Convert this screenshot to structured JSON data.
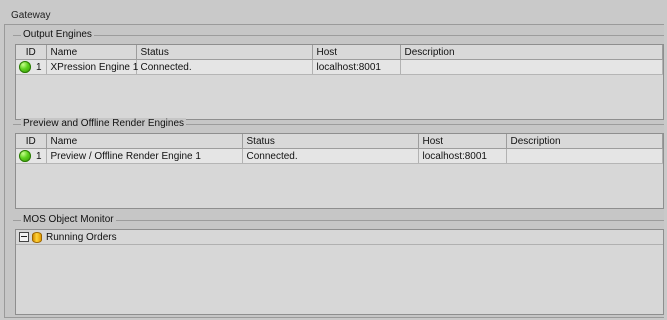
{
  "window": {
    "title": "Gateway"
  },
  "output_engines": {
    "legend": "Output Engines",
    "columns": [
      "ID",
      "Name",
      "Status",
      "Host",
      "Description"
    ],
    "rows": [
      {
        "id": "1",
        "name": "XPression Engine 1",
        "status": "Connected.",
        "host": "localhost:8001",
        "description": ""
      }
    ]
  },
  "preview_engines": {
    "legend": "Preview and Offline Render Engines",
    "columns": [
      "ID",
      "Name",
      "Status",
      "Host",
      "Description"
    ],
    "rows": [
      {
        "id": "1",
        "name": "Preview / Offline Render Engine 1",
        "status": "Connected.",
        "host": "localhost:8001",
        "description": ""
      }
    ]
  },
  "mos_monitor": {
    "legend": "MOS Object Monitor",
    "tree": [
      {
        "label": "Running Orders",
        "icon": "database-icon"
      }
    ]
  },
  "colors": {
    "status_connected": "#5ed21e"
  }
}
